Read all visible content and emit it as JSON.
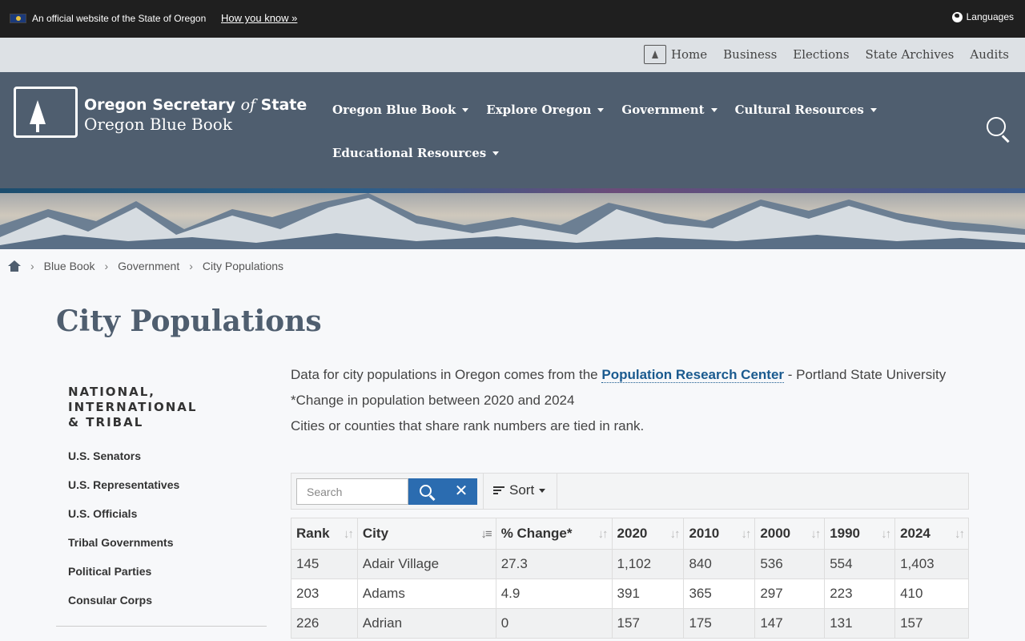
{
  "banner": {
    "official_text": "An official website of the State of Oregon",
    "how_link": "How you know »",
    "languages": "Languages"
  },
  "utility_nav": [
    "Home",
    "Business",
    "Elections",
    "State Archives",
    "Audits"
  ],
  "header": {
    "title_a": "Oregon Secretary ",
    "title_of": "of",
    "title_b": " State",
    "subtitle": "Oregon Blue Book",
    "nav": [
      "Oregon Blue Book",
      "Explore Oregon",
      "Government",
      "Cultural Resources",
      "Educational Resources"
    ]
  },
  "breadcrumb": [
    "Blue Book",
    "Government",
    "City Populations"
  ],
  "page_title": "City Populations",
  "sidebar": {
    "heading": "NATIONAL, INTERNATIONAL & TRIBAL",
    "items": [
      "U.S. Senators",
      "U.S. Representatives",
      "U.S. Officials",
      "Tribal Governments",
      "Political Parties",
      "Consular Corps"
    ]
  },
  "content": {
    "intro_before": "Data for city populations in Oregon comes from the ",
    "intro_link": "Population Research Center",
    "intro_after": " - Portland State University",
    "note_change": "*Change in population between 2020 and 2024",
    "note_tied": "Cities or counties that share rank numbers are tied in rank."
  },
  "toolbar": {
    "search_placeholder": "Search",
    "clear": "✕",
    "sort_label": "Sort"
  },
  "table": {
    "headers": [
      "Rank",
      "City",
      "% Change*",
      "2020",
      "2010",
      "2000",
      "1990",
      "2024"
    ],
    "rows": [
      [
        "145",
        "Adair Village",
        "27.3",
        "1,102",
        "840",
        "536",
        "554",
        "1,403"
      ],
      [
        "203",
        "Adams",
        "4.9",
        "391",
        "365",
        "297",
        "223",
        "410"
      ],
      [
        "226",
        "Adrian",
        "0",
        "157",
        "175",
        "147",
        "131",
        "157"
      ]
    ]
  }
}
